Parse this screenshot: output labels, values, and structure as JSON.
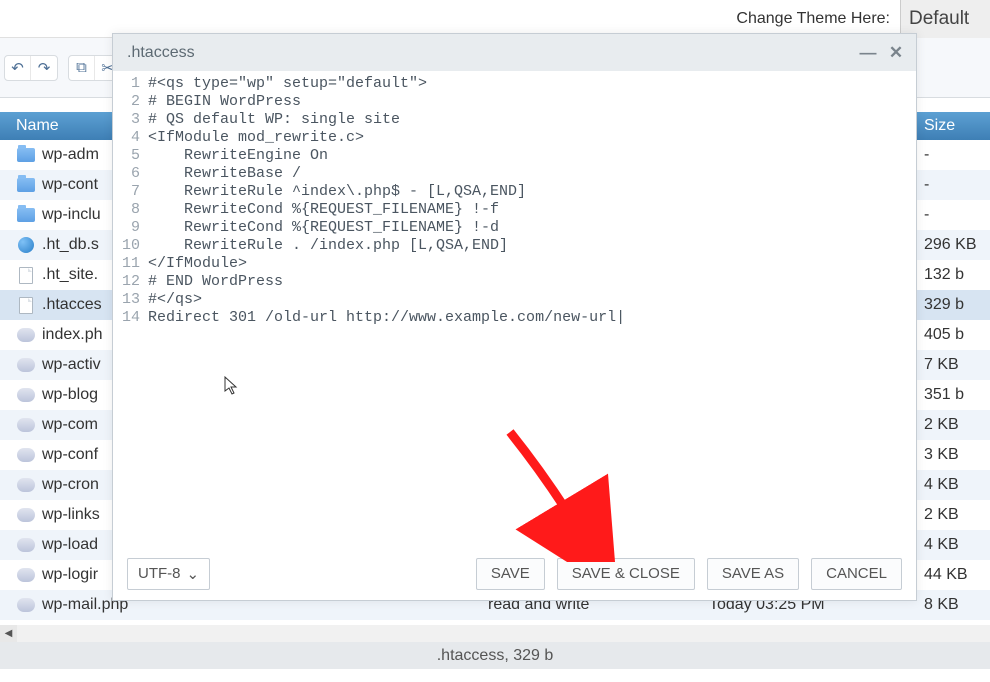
{
  "theme_label": "Change Theme Here:",
  "theme_value": "Default",
  "columns": {
    "name": "Name",
    "size": "Size"
  },
  "files": [
    {
      "icon": "folder",
      "name": "wp-admin",
      "meta": "",
      "size": "-",
      "trunc": "wp-adm"
    },
    {
      "icon": "folder",
      "name": "wp-content",
      "meta": "",
      "size": "-",
      "trunc": "wp-cont"
    },
    {
      "icon": "folder",
      "name": "wp-includes",
      "meta": "",
      "size": "-",
      "trunc": "wp-inclu"
    },
    {
      "icon": "globe",
      "name": ".ht_db.sql",
      "meta": "",
      "size": "296 KB",
      "trunc": ".ht_db.s"
    },
    {
      "icon": "file",
      "name": ".ht_site.json",
      "meta": "",
      "size": "132 b",
      "trunc": ".ht_site."
    },
    {
      "icon": "file",
      "name": ".htaccess",
      "meta": "",
      "size": "329 b",
      "trunc": ".htacces",
      "sel": true
    },
    {
      "icon": "php",
      "name": "index.php",
      "meta": "",
      "size": "405 b",
      "trunc": "index.ph"
    },
    {
      "icon": "php",
      "name": "wp-activate.php",
      "meta": "",
      "size": "7 KB",
      "trunc": "wp-activ"
    },
    {
      "icon": "php",
      "name": "wp-blog-header.php",
      "meta": "",
      "size": "351 b",
      "trunc": "wp-blog"
    },
    {
      "icon": "php",
      "name": "wp-comments-post.php",
      "meta": "",
      "size": "2 KB",
      "trunc": "wp-com"
    },
    {
      "icon": "php",
      "name": "wp-config.php",
      "meta": "",
      "size": "3 KB",
      "trunc": "wp-conf"
    },
    {
      "icon": "php",
      "name": "wp-cron.php",
      "meta": "",
      "size": "4 KB",
      "trunc": "wp-cron"
    },
    {
      "icon": "php",
      "name": "wp-links-opml.php",
      "meta": "",
      "size": "2 KB",
      "trunc": "wp-links"
    },
    {
      "icon": "php",
      "name": "wp-load.php",
      "meta": "",
      "size": "4 KB",
      "trunc": "wp-load"
    },
    {
      "icon": "php",
      "name": "wp-login.php",
      "meta": "",
      "size": "44 KB",
      "trunc": "wp-logir"
    },
    {
      "icon": "php",
      "name": "wp-mail.php",
      "meta": "read and write",
      "meta2": "Today 03:25 PM",
      "size": "8 KB",
      "trunc": "wp-mail.php"
    }
  ],
  "status_bar": ".htaccess, 329 b",
  "editor": {
    "title": ".htaccess",
    "encoding": "UTF-8",
    "buttons": {
      "save": "SAVE",
      "save_close": "SAVE & CLOSE",
      "save_as": "SAVE AS",
      "cancel": "CANCEL"
    },
    "lines": [
      "#<qs type=\"wp\" setup=\"default\">",
      "# BEGIN WordPress",
      "# QS default WP: single site",
      "<IfModule mod_rewrite.c>",
      "    RewriteEngine On",
      "    RewriteBase /",
      "    RewriteRule ^index\\.php$ - [L,QSA,END]",
      "    RewriteCond %{REQUEST_FILENAME} !-f",
      "    RewriteCond %{REQUEST_FILENAME} !-d",
      "    RewriteRule . /index.php [L,QSA,END]",
      "</IfModule>",
      "# END WordPress",
      "#</qs>",
      "Redirect 301 /old-url http://www.example.com/new-url"
    ]
  }
}
